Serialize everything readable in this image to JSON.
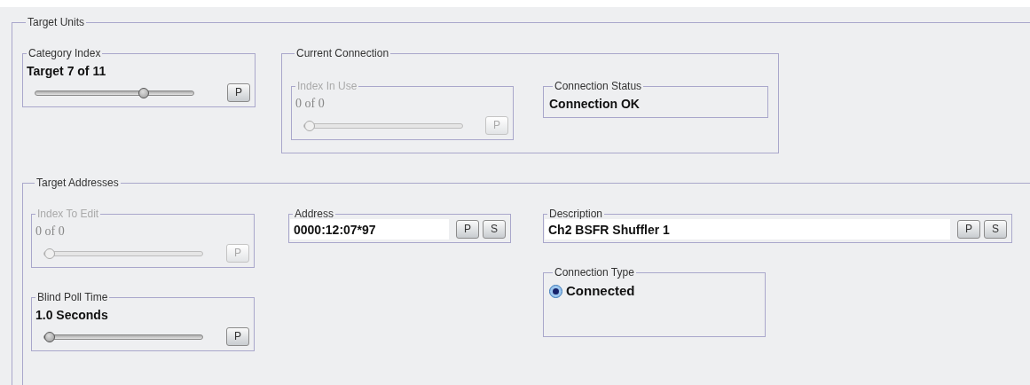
{
  "target_units": {
    "title": "Target Units",
    "category_index": {
      "title": "Category Index",
      "value": "Target 7 of 11",
      "disabled": false,
      "level": 0.69,
      "buttons": [
        "P"
      ]
    },
    "current_connection": {
      "title": "Current Connection",
      "index_in_use": {
        "title": "Index In Use",
        "value": "0 of 0",
        "disabled": true,
        "level": 0,
        "buttons": [
          "P"
        ]
      },
      "connection_status": {
        "title": "Connection Status",
        "value": "Connection OK"
      }
    },
    "target_addresses": {
      "title": "Target Addresses",
      "index_to_edit": {
        "title": "Index To Edit",
        "value": "0 of 0",
        "disabled": true,
        "level": 0,
        "buttons": [
          "P"
        ]
      },
      "blind_poll_time": {
        "title": "Blind Poll Time",
        "value": "1.0 Seconds",
        "disabled": false,
        "level": 0,
        "buttons": [
          "P"
        ]
      },
      "address": {
        "title": "Address",
        "value": "0000:12:07*97",
        "buttons": [
          "P",
          "S"
        ]
      },
      "description": {
        "title": "Description",
        "value": "Ch2 BSFR Shuffler 1",
        "buttons": [
          "P",
          "S"
        ]
      },
      "connection_type": {
        "title": "Connection Type",
        "options": [
          {
            "label": "Connected",
            "selected": true
          }
        ]
      }
    }
  }
}
